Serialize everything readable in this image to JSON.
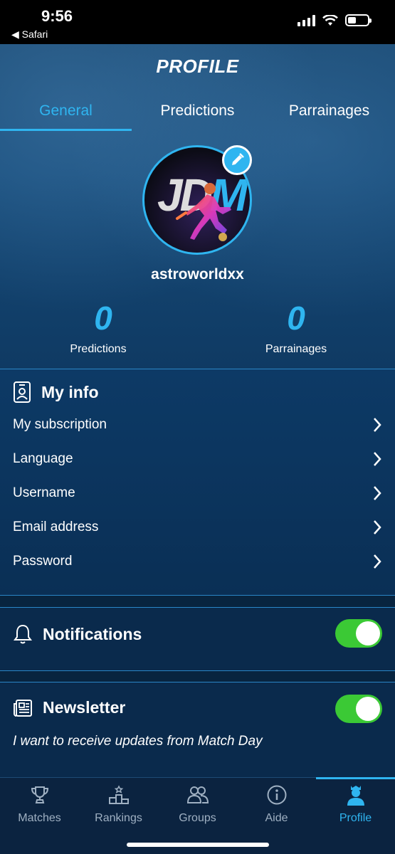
{
  "status_bar": {
    "time": "9:56",
    "back_app": "◀ Safari"
  },
  "header": {
    "title": "PROFILE"
  },
  "tabs": [
    {
      "label": "General",
      "active": true
    },
    {
      "label": "Predictions",
      "active": false
    },
    {
      "label": "Parrainages",
      "active": false
    }
  ],
  "profile": {
    "avatar_logo": {
      "j": "J",
      "d": "D",
      "m": "M"
    },
    "username": "astroworldxx",
    "stats": [
      {
        "value": "0",
        "label": "Predictions"
      },
      {
        "value": "0",
        "label": "Parrainages"
      }
    ]
  },
  "my_info": {
    "title": "My info",
    "items": [
      {
        "label": "My subscription"
      },
      {
        "label": "Language"
      },
      {
        "label": "Username"
      },
      {
        "label": "Email address"
      },
      {
        "label": "Password"
      }
    ]
  },
  "notifications": {
    "title": "Notifications",
    "enabled": true
  },
  "newsletter": {
    "title": "Newsletter",
    "enabled": true,
    "description": "I want to receive updates from Match Day"
  },
  "tabbar": [
    {
      "label": "Matches",
      "icon": "trophy-icon",
      "active": false
    },
    {
      "label": "Rankings",
      "icon": "podium-icon",
      "active": false
    },
    {
      "label": "Groups",
      "icon": "group-icon",
      "active": false
    },
    {
      "label": "Aide",
      "icon": "info-icon",
      "active": false
    },
    {
      "label": "Profile",
      "icon": "profile-icon",
      "active": true
    }
  ],
  "colors": {
    "accent": "#2fb5f0",
    "toggle_on": "#3bc935",
    "background": "#0a2a4c"
  }
}
